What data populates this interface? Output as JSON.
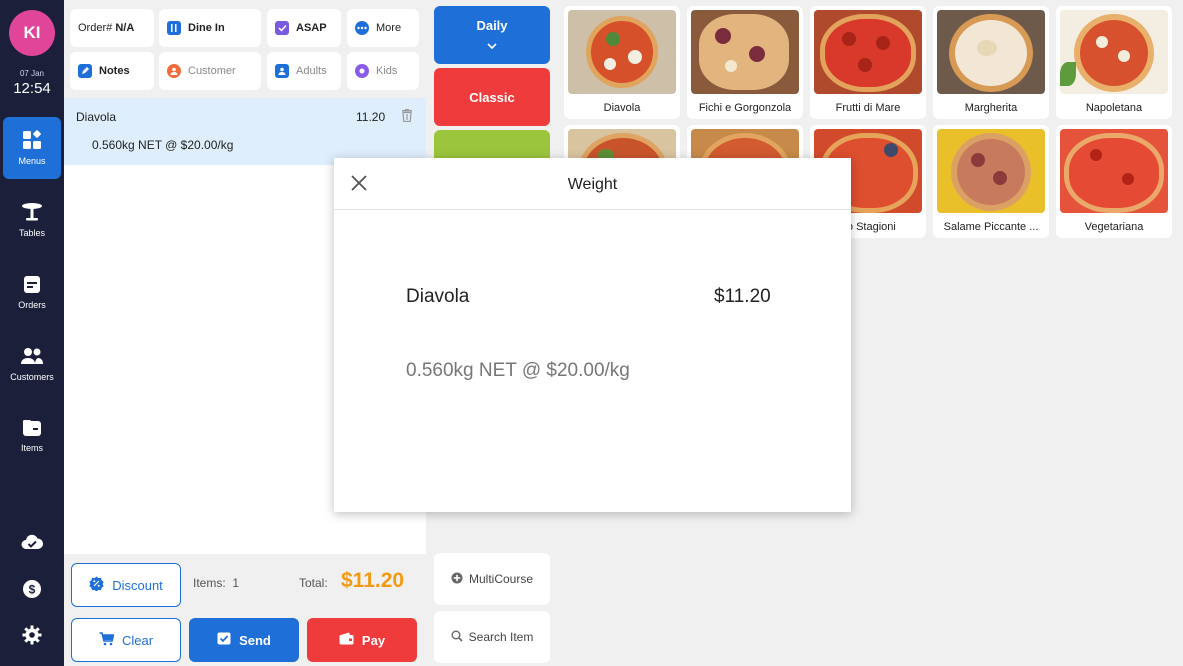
{
  "sidebar": {
    "avatar_initials": "KI",
    "date": "07 Jan",
    "time": "12:54",
    "items": [
      {
        "label": "Menus",
        "icon": "menus-icon"
      },
      {
        "label": "Tables",
        "icon": "table-icon"
      },
      {
        "label": "Orders",
        "icon": "orders-icon"
      },
      {
        "label": "Customers",
        "icon": "customers-icon"
      },
      {
        "label": "Items",
        "icon": "items-icon"
      }
    ]
  },
  "order_header": {
    "order_prefix": "Order#",
    "order_number": "N/A",
    "dine_in": "Dine In",
    "asap": "ASAP",
    "more": "More",
    "notes": "Notes",
    "customer": "Customer",
    "adults": "Adults",
    "kids": "Kids"
  },
  "order_lines": [
    {
      "name": "Diavola",
      "price": "11.20",
      "detail": "0.560kg NET @ $20.00/kg"
    }
  ],
  "footer": {
    "discount": "Discount",
    "items_label": "Items:",
    "items_count": "1",
    "total_label": "Total:",
    "total_value": "$11.20",
    "clear": "Clear",
    "send": "Send",
    "pay": "Pay"
  },
  "categories": [
    {
      "label": "Daily",
      "color": "#1f6fd8"
    },
    {
      "label": "Classic",
      "color": "#ef3b3b"
    },
    {
      "label": "",
      "color": "#9bc53d"
    }
  ],
  "utility": {
    "multicourse": "MultiCourse",
    "search": "Search Item"
  },
  "products": [
    {
      "name": "Diavola"
    },
    {
      "name": "Fichi e Gorgonzola"
    },
    {
      "name": "Frutti di Mare"
    },
    {
      "name": "Margherita"
    },
    {
      "name": "Napoletana"
    },
    {
      "name": ""
    },
    {
      "name": ""
    },
    {
      "name": "tro Stagioni"
    },
    {
      "name": "Salame Piccante ..."
    },
    {
      "name": "Vegetariana"
    }
  ],
  "modal": {
    "title": "Weight",
    "item_name": "Diavola",
    "item_price": "$11.20",
    "detail": "0.560kg NET @ $20.00/kg"
  },
  "colors": {
    "sidebar_bg": "#1c1f3a",
    "accent_blue": "#1f6fd8",
    "accent_red": "#ef3b3b",
    "total_orange": "#f39a14",
    "avatar_pink": "#e0459a"
  }
}
